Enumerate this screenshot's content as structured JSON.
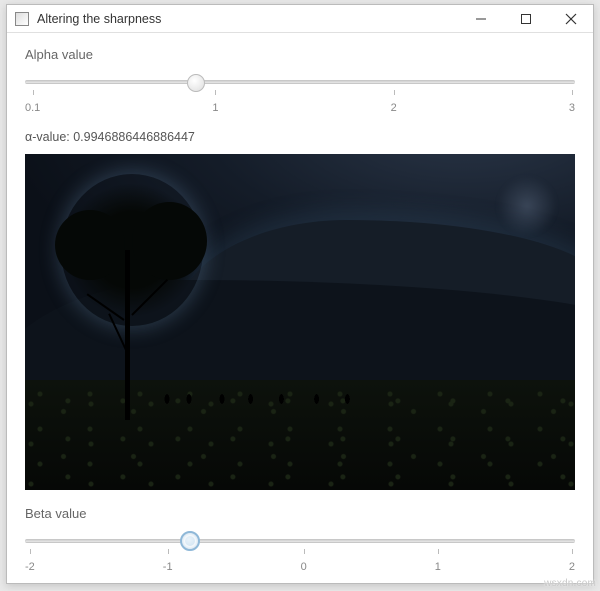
{
  "window": {
    "title": "Altering the sharpness"
  },
  "alpha": {
    "label": "Alpha value",
    "ticks": [
      "0.1",
      "1",
      "2",
      "3"
    ],
    "value_fraction": 0.31,
    "readout": "α-value: 0.9946886446886447"
  },
  "beta": {
    "label": "Beta value",
    "ticks": [
      "-2",
      "-1",
      "0",
      "1",
      "2"
    ],
    "value_fraction": 0.3
  },
  "watermark": "wsxdn.com"
}
